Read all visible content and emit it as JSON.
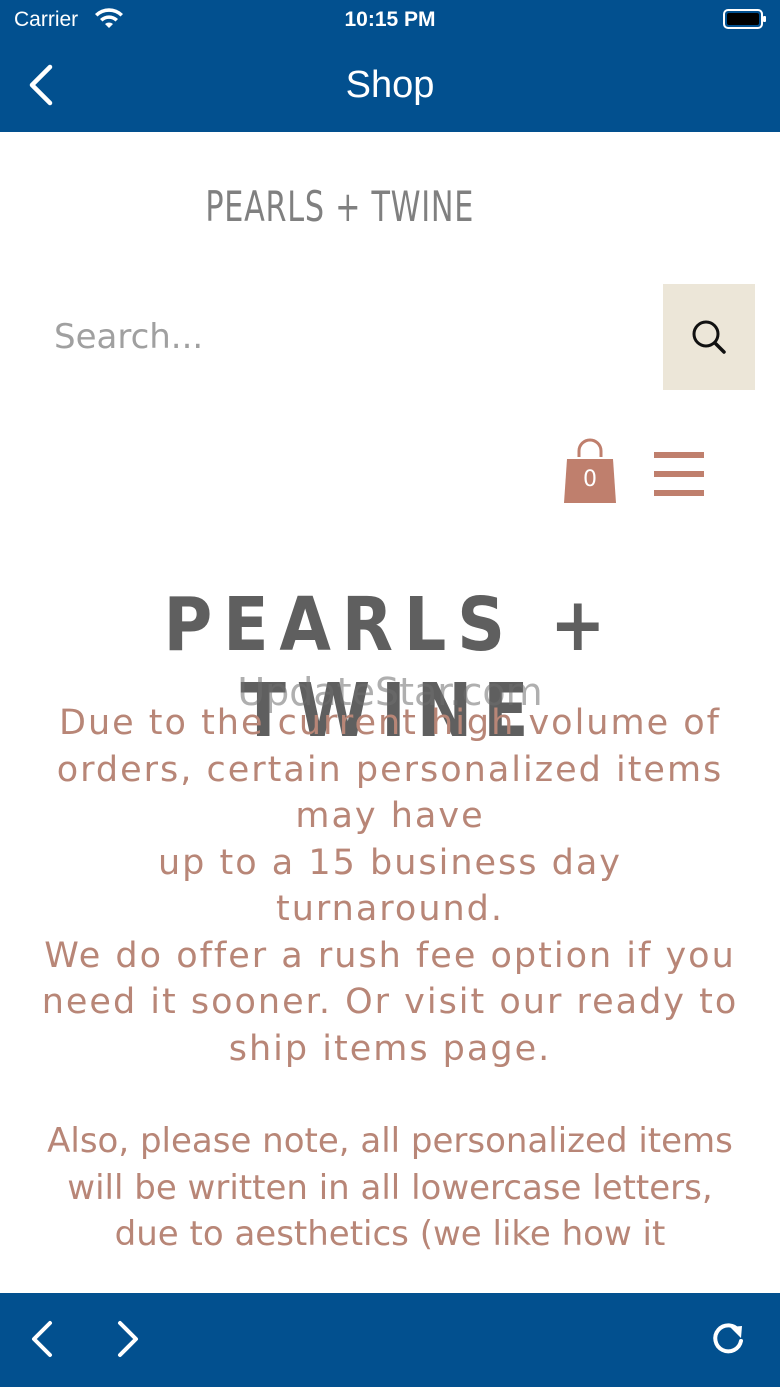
{
  "status_bar": {
    "carrier": "Carrier",
    "time": "10:15 PM"
  },
  "navbar": {
    "title": "Shop"
  },
  "header": {
    "brand": "PEARLS + TWINE"
  },
  "search": {
    "placeholder": "Search..."
  },
  "cart": {
    "count": "0"
  },
  "hero": {
    "brand": "PEARLS + TWINE",
    "watermark": "UpdateStar.com"
  },
  "notice": {
    "lines": [
      "Due to the current high volume of orders, certain personalized items may have",
      "up to a 15 business day turnaround.",
      "We do offer a rush fee option if you need it sooner. Or visit our ready to ship items page."
    ]
  },
  "note2": {
    "lines": [
      "Also, please note, all personalized items will be written in all lowercase letters,",
      "due to aesthetics (we like how it"
    ]
  },
  "colors": {
    "bar": "#02508f",
    "accent": "#bf7f6d",
    "text": "#b88677",
    "search_button_bg": "#ece6d8"
  },
  "icons": {
    "back": "chevron-left-icon",
    "search": "search-icon",
    "cart": "shopping-bag-icon",
    "menu": "hamburger-icon",
    "browser_back": "chevron-left-icon",
    "browser_forward": "chevron-right-icon",
    "reload": "reload-icon"
  }
}
